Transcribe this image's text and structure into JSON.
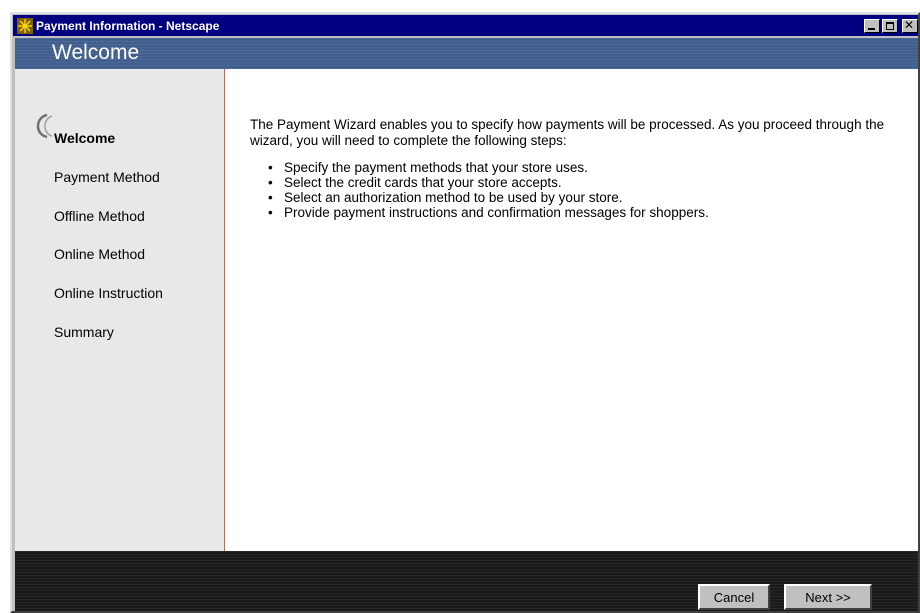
{
  "window": {
    "title": "Payment Information - Netscape",
    "icons": {
      "app": "netscape-wheel-icon",
      "minimize": "minimize-icon",
      "maximize": "maximize-icon",
      "close": "close-icon"
    },
    "close_glyph": "✕"
  },
  "header": {
    "title": "Welcome"
  },
  "sidebar": {
    "active_marker_icon": "crescent-marker-icon",
    "steps": [
      {
        "label": "Welcome",
        "active": true
      },
      {
        "label": "Payment Method",
        "active": false
      },
      {
        "label": "Offline Method",
        "active": false
      },
      {
        "label": "Online Method",
        "active": false
      },
      {
        "label": "Online Instruction",
        "active": false
      },
      {
        "label": "Summary",
        "active": false
      }
    ]
  },
  "main": {
    "intro": "The Payment Wizard enables you to specify how payments will be processed. As you proceed through the wizard, you will need to complete the following steps:",
    "bullets": [
      "Specify the payment methods that your store uses.",
      "Select the credit cards that your store accepts.",
      "Select an authorization method to be used by your store.",
      "Provide payment instructions and confirmation messages for shoppers."
    ]
  },
  "footer": {
    "cancel_label": "Cancel",
    "next_label": "Next >>"
  },
  "colors": {
    "titlebar": "#000080",
    "header_band": "#405e8e",
    "sidebar_bg": "#e8e8e8",
    "sidebar_divider": "#c26a5a",
    "footer_band": "#1a1a1a",
    "button_face": "#c0c0c0"
  }
}
